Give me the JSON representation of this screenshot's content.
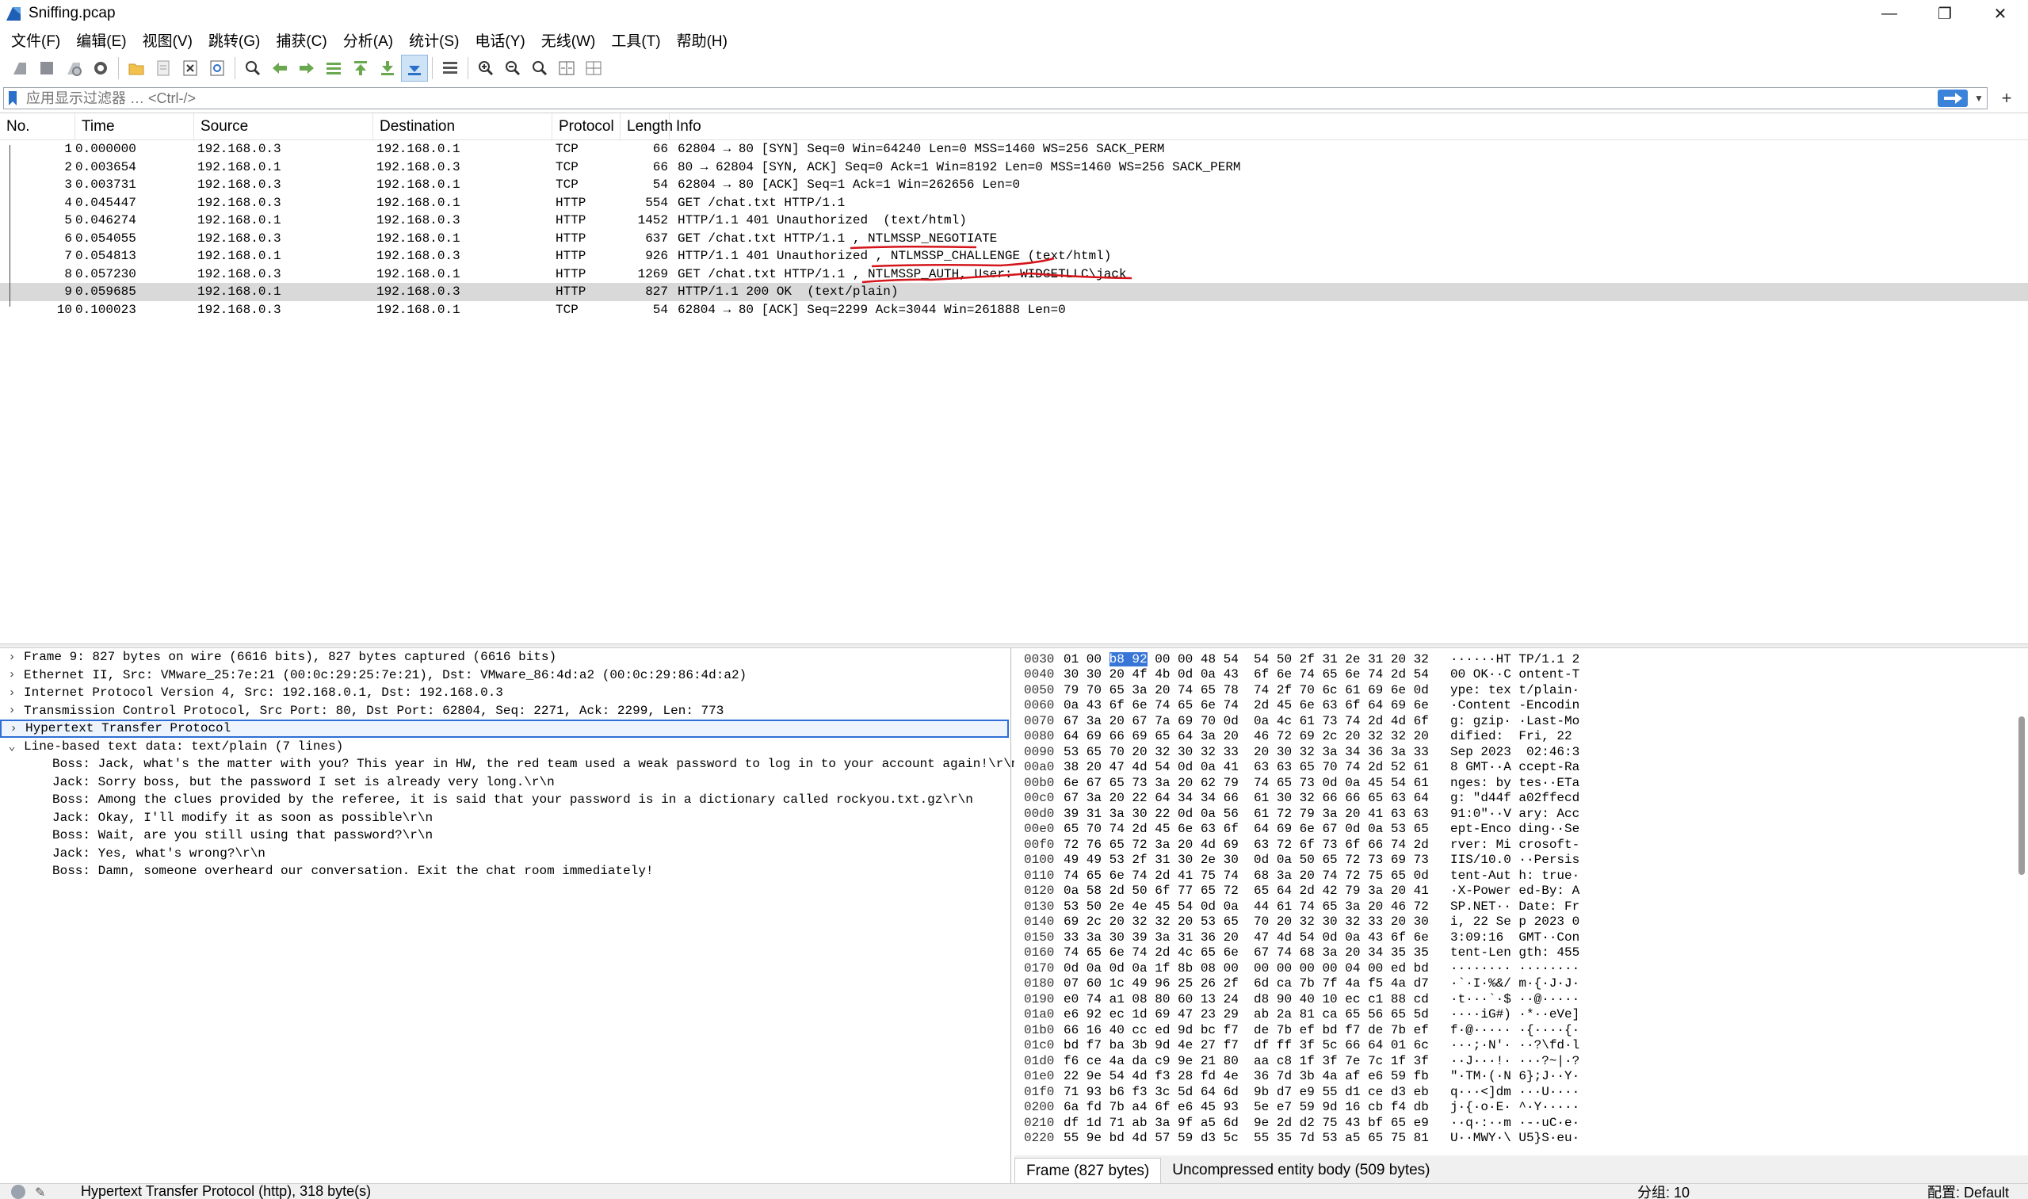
{
  "window": {
    "title": "Sniffing.pcap",
    "minimize": "—",
    "restore": "❐",
    "close": "✕"
  },
  "menu": [
    "文件(F)",
    "编辑(E)",
    "视图(V)",
    "跳转(G)",
    "捕获(C)",
    "分析(A)",
    "统计(S)",
    "电话(Y)",
    "无线(W)",
    "工具(T)",
    "帮助(H)"
  ],
  "filter": {
    "placeholder": "应用显示过滤器 … <Ctrl-/>",
    "plus": "+"
  },
  "packet_list": {
    "headers": {
      "no": "No.",
      "time": "Time",
      "source": "Source",
      "destination": "Destination",
      "protocol": "Protocol",
      "length": "Length",
      "info": "Info"
    },
    "rows": [
      {
        "no": "1",
        "time": "0.000000",
        "src": "192.168.0.3",
        "dst": "192.168.0.1",
        "proto": "TCP",
        "len": "66",
        "info": "62804 → 80 [SYN] Seq=0 Win=64240 Len=0 MSS=1460 WS=256 SACK_PERM"
      },
      {
        "no": "2",
        "time": "0.003654",
        "src": "192.168.0.1",
        "dst": "192.168.0.3",
        "proto": "TCP",
        "len": "66",
        "info": "80 → 62804 [SYN, ACK] Seq=0 Ack=1 Win=8192 Len=0 MSS=1460 WS=256 SACK_PERM"
      },
      {
        "no": "3",
        "time": "0.003731",
        "src": "192.168.0.3",
        "dst": "192.168.0.1",
        "proto": "TCP",
        "len": "54",
        "info": "62804 → 80 [ACK] Seq=1 Ack=1 Win=262656 Len=0"
      },
      {
        "no": "4",
        "time": "0.045447",
        "src": "192.168.0.3",
        "dst": "192.168.0.1",
        "proto": "HTTP",
        "len": "554",
        "info": "GET /chat.txt HTTP/1.1"
      },
      {
        "no": "5",
        "time": "0.046274",
        "src": "192.168.0.1",
        "dst": "192.168.0.3",
        "proto": "HTTP",
        "len": "1452",
        "info": "HTTP/1.1 401 Unauthorized  (text/html)"
      },
      {
        "no": "6",
        "time": "0.054055",
        "src": "192.168.0.3",
        "dst": "192.168.0.1",
        "proto": "HTTP",
        "len": "637",
        "info": "GET /chat.txt HTTP/1.1 , NTLMSSP_NEGOTIATE"
      },
      {
        "no": "7",
        "time": "0.054813",
        "src": "192.168.0.1",
        "dst": "192.168.0.3",
        "proto": "HTTP",
        "len": "926",
        "info": "HTTP/1.1 401 Unauthorized , NTLMSSP_CHALLENGE (text/html)"
      },
      {
        "no": "8",
        "time": "0.057230",
        "src": "192.168.0.3",
        "dst": "192.168.0.1",
        "proto": "HTTP",
        "len": "1269",
        "info": "GET /chat.txt HTTP/1.1 , NTLMSSP_AUTH, User: WIDGETLLC\\jack"
      },
      {
        "no": "9",
        "time": "0.059685",
        "src": "192.168.0.1",
        "dst": "192.168.0.3",
        "proto": "HTTP",
        "len": "827",
        "info": "HTTP/1.1 200 OK  (text/plain)"
      },
      {
        "no": "10",
        "time": "0.100023",
        "src": "192.168.0.3",
        "dst": "192.168.0.1",
        "proto": "TCP",
        "len": "54",
        "info": "62804 → 80 [ACK] Seq=2299 Ack=3044 Win=261888 Len=0"
      }
    ],
    "selected_row": "9"
  },
  "details": {
    "frame": "Frame 9: 827 bytes on wire (6616 bits), 827 bytes captured (6616 bits)",
    "ethernet": "Ethernet II, Src: VMware_25:7e:21 (00:0c:29:25:7e:21), Dst: VMware_86:4d:a2 (00:0c:29:86:4d:a2)",
    "ip": "Internet Protocol Version 4, Src: 192.168.0.1, Dst: 192.168.0.3",
    "tcp": "Transmission Control Protocol, Src Port: 80, Dst Port: 62804, Seq: 2271, Ack: 2299, Len: 773",
    "http": "Hypertext Transfer Protocol",
    "text": "Line-based text data: text/plain (7 lines)",
    "lines": [
      "Boss: Jack, what's the matter with you? This year in HW, the red team used a weak password to log in to your account again!\\r\\n",
      "Jack: Sorry boss, but the password I set is already very long.\\r\\n",
      "Boss: Among the clues provided by the referee, it is said that your password is in a dictionary called rockyou.txt.gz\\r\\n",
      "Jack: Okay, I'll modify it as soon as possible\\r\\n",
      "Boss: Wait, are you still using that password?\\r\\n",
      "Jack: Yes, what's wrong?\\r\\n",
      "Boss: Damn, someone overheard our conversation. Exit the chat room immediately!"
    ]
  },
  "bytes": {
    "rows": [
      {
        "off": "0030",
        "hex": "01 00 b8 92 00 00 48 54  54 50 2f 31 2e 31 20 32",
        "asc": "······HT TP/1.1 2"
      },
      {
        "off": "0040",
        "hex": "30 30 20 4f 4b 0d 0a 43  6f 6e 74 65 6e 74 2d 54",
        "asc": "00 OK··C ontent-T"
      },
      {
        "off": "0050",
        "hex": "79 70 65 3a 20 74 65 78  74 2f 70 6c 61 69 6e 0d",
        "asc": "ype: tex t/plain·"
      },
      {
        "off": "0060",
        "hex": "0a 43 6f 6e 74 65 6e 74  2d 45 6e 63 6f 64 69 6e",
        "asc": "·Content -Encodin"
      },
      {
        "off": "0070",
        "hex": "67 3a 20 67 7a 69 70 0d  0a 4c 61 73 74 2d 4d 6f",
        "asc": "g: gzip· ·Last-Mo"
      },
      {
        "off": "0080",
        "hex": "64 69 66 69 65 64 3a 20  46 72 69 2c 20 32 32 20",
        "asc": "dified:  Fri, 22 "
      },
      {
        "off": "0090",
        "hex": "53 65 70 20 32 30 32 33  20 30 32 3a 34 36 3a 33",
        "asc": "Sep 2023  02:46:3"
      },
      {
        "off": "00a0",
        "hex": "38 20 47 4d 54 0d 0a 41  63 63 65 70 74 2d 52 61",
        "asc": "8 GMT··A ccept-Ra"
      },
      {
        "off": "00b0",
        "hex": "6e 67 65 73 3a 20 62 79  74 65 73 0d 0a 45 54 61",
        "asc": "nges: by tes··ETa"
      },
      {
        "off": "00c0",
        "hex": "67 3a 20 22 64 34 34 66  61 30 32 66 66 65 63 64",
        "asc": "g: \"d44f a02ffecd"
      },
      {
        "off": "00d0",
        "hex": "39 31 3a 30 22 0d 0a 56  61 72 79 3a 20 41 63 63",
        "asc": "91:0\"··V ary: Acc"
      },
      {
        "off": "00e0",
        "hex": "65 70 74 2d 45 6e 63 6f  64 69 6e 67 0d 0a 53 65",
        "asc": "ept-Enco ding··Se"
      },
      {
        "off": "00f0",
        "hex": "72 76 65 72 3a 20 4d 69  63 72 6f 73 6f 66 74 2d",
        "asc": "rver: Mi crosoft-"
      },
      {
        "off": "0100",
        "hex": "49 49 53 2f 31 30 2e 30  0d 0a 50 65 72 73 69 73",
        "asc": "IIS/10.0 ··Persis"
      },
      {
        "off": "0110",
        "hex": "74 65 6e 74 2d 41 75 74  68 3a 20 74 72 75 65 0d",
        "asc": "tent-Aut h: true·"
      },
      {
        "off": "0120",
        "hex": "0a 58 2d 50 6f 77 65 72  65 64 2d 42 79 3a 20 41",
        "asc": "·X-Power ed-By: A"
      },
      {
        "off": "0130",
        "hex": "53 50 2e 4e 45 54 0d 0a  44 61 74 65 3a 20 46 72",
        "asc": "SP.NET·· Date: Fr"
      },
      {
        "off": "0140",
        "hex": "69 2c 20 32 32 20 53 65  70 20 32 30 32 33 20 30",
        "asc": "i, 22 Se p 2023 0"
      },
      {
        "off": "0150",
        "hex": "33 3a 30 39 3a 31 36 20  47 4d 54 0d 0a 43 6f 6e",
        "asc": "3:09:16  GMT··Con"
      },
      {
        "off": "0160",
        "hex": "74 65 6e 74 2d 4c 65 6e  67 74 68 3a 20 34 35 35",
        "asc": "tent-Len gth: 455"
      },
      {
        "off": "0170",
        "hex": "0d 0a 0d 0a 1f 8b 08 00  00 00 00 00 04 00 ed bd",
        "asc": "········ ········"
      },
      {
        "off": "0180",
        "hex": "07 60 1c 49 96 25 26 2f  6d ca 7b 7f 4a f5 4a d7",
        "asc": "·`·I·%&/ m·{·J·J·"
      },
      {
        "off": "0190",
        "hex": "e0 74 a1 08 80 60 13 24  d8 90 40 10 ec c1 88 cd",
        "asc": "·t···`·$ ··@·····"
      },
      {
        "off": "01a0",
        "hex": "e6 92 ec 1d 69 47 23 29  ab 2a 81 ca 65 56 65 5d",
        "asc": "····iG#) ·*··eVe]"
      },
      {
        "off": "01b0",
        "hex": "66 16 40 cc ed 9d bc f7  de 7b ef bd f7 de 7b ef",
        "asc": "f·@····· ·{····{·"
      },
      {
        "off": "01c0",
        "hex": "bd f7 ba 3b 9d 4e 27 f7  df ff 3f 5c 66 64 01 6c",
        "asc": "···;·N'· ··?\\fd·l"
      },
      {
        "off": "01d0",
        "hex": "f6 ce 4a da c9 9e 21 80  aa c8 1f 3f 7e 7c 1f 3f",
        "asc": "··J···!· ···?~|·?"
      },
      {
        "off": "01e0",
        "hex": "22 9e 54 4d f3 28 fd 4e  36 7d 3b 4a af e6 59 fb",
        "asc": "\"·TM·(·N 6};J··Y·"
      },
      {
        "off": "01f0",
        "hex": "71 93 b6 f3 3c 5d 64 6d  9b d7 e9 55 d1 ce d3 eb",
        "asc": "q···<]dm ···U····"
      },
      {
        "off": "0200",
        "hex": "6a fd 7b a4 6f e6 45 93  5e e7 59 9d 16 cb f4 db",
        "asc": "j·{·o·E· ^·Y·····"
      },
      {
        "off": "0210",
        "hex": "df 1d 71 ab 3a 9f a5 6d  9e 2d d2 75 43 bf 65 e9",
        "asc": "··q·:··m ·-·uC·e·"
      },
      {
        "off": "0220",
        "hex": "55 9e bd 4d 57 59 d3 5c  55 35 7d 53 a5 65 75 81",
        "asc": "U··MWY·\\ U5}S·eu·"
      }
    ]
  },
  "bytetabs": [
    "Frame (827 bytes)",
    "Uncompressed entity body (509 bytes)"
  ],
  "status": {
    "text": "Hypertext Transfer Protocol (http), 318 byte(s)",
    "packets": "分组: 10",
    "profile": "配置: Default"
  },
  "colors": {
    "selection": "#d9d9d9",
    "accent": "#3776d6",
    "annotation_red": "#d4151b"
  }
}
